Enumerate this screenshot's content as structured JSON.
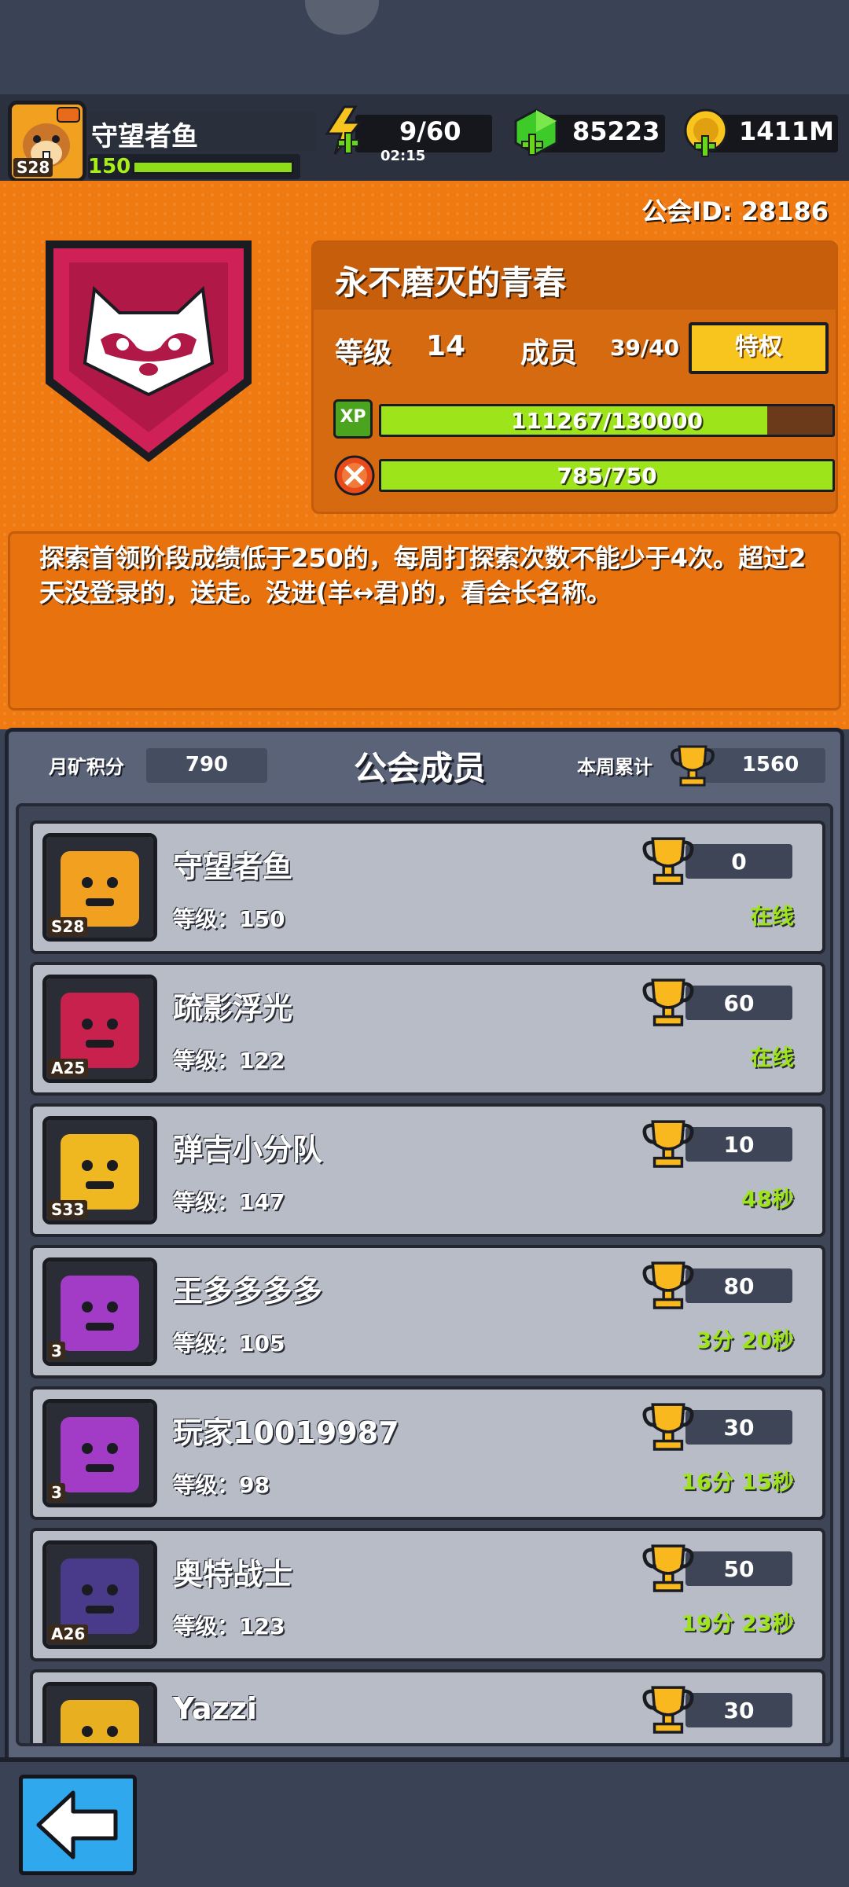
{
  "player": {
    "name": "守望者鱼",
    "level": "150",
    "rank_badge": "S28"
  },
  "resources": {
    "energy": "9/60",
    "energy_timer": "02:15",
    "gems": "85223",
    "gold": "1411M"
  },
  "guild": {
    "id_text": "公会ID: 28186",
    "name": "永不磨灭的青春",
    "level_label": "等级",
    "level_value": "14",
    "member_label": "成员",
    "member_count": "39/40",
    "privilege_button": "特权",
    "xp_icon": "XP",
    "xp_text": "111267/130000",
    "xp_fraction": 0.856,
    "task_text": "785/750",
    "task_fraction": 1.0,
    "notice": "探索首领阶段成绩低于250的，每周打探索次数不能少于4次。超过2天没登录的，送走。没进(羊↔君)的，看会长名称。"
  },
  "members_panel": {
    "month_label": "月矿积分",
    "month_value": "790",
    "title": "公会成员",
    "week_label": "本周累计",
    "week_value": "1560"
  },
  "members": [
    {
      "name": "守望者鱼",
      "level": "等级：150",
      "score": "0",
      "status": "在线",
      "badge": "S28",
      "avatar_color": "#f2a020"
    },
    {
      "name": "疏影浮光",
      "level": "等级：122",
      "score": "60",
      "status": "在线",
      "badge": "A25",
      "avatar_color": "#c8214d"
    },
    {
      "name": "弹吉小分队",
      "level": "等级：147",
      "score": "10",
      "status": "48秒",
      "badge": "S33",
      "avatar_color": "#f0b820"
    },
    {
      "name": "王多多多多",
      "level": "等级：105",
      "score": "80",
      "status": "3分 20秒",
      "badge": "3",
      "avatar_color": "#a23cc6"
    },
    {
      "name": "玩家10019987",
      "level": "等级：98",
      "score": "30",
      "status": "16分 15秒",
      "badge": "3",
      "avatar_color": "#a23cc6"
    },
    {
      "name": "奥特战士",
      "level": "等级：123",
      "score": "50",
      "status": "19分 23秒",
      "badge": "A26",
      "avatar_color": "#4a3a8a"
    },
    {
      "name": "Yazzi",
      "level": "",
      "score": "30",
      "status": "",
      "badge": "",
      "avatar_color": "#e8b020"
    }
  ],
  "colors": {
    "accent_orange": "#f07a12",
    "bar_green": "#9ee41a",
    "privilege_yellow": "#f8c41e",
    "back_blue": "#2fa8ee"
  },
  "icons": {
    "energy": "lightning-icon",
    "gems": "gem-icon",
    "gold": "coin-icon",
    "guild_emblem": "raccoon-shield-icon",
    "trophy": "trophy-icon",
    "back": "back-arrow-icon"
  }
}
